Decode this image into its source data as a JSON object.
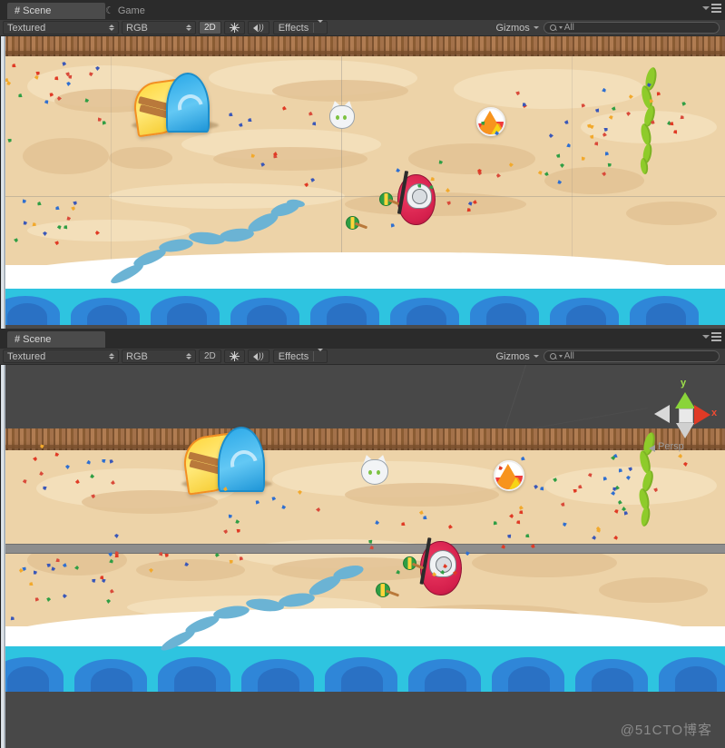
{
  "window": {
    "watermark": "@51CTO博客"
  },
  "panels": [
    {
      "id": "panel-top",
      "tabs": [
        {
          "label": "Scene",
          "icon": "grid-hash-icon",
          "active": true
        },
        {
          "label": "Game",
          "icon": "game-moon-icon",
          "active": false
        }
      ],
      "toolbar": {
        "draw_mode": "Textured",
        "color_mode": "RGB",
        "toggle_2d": "2D",
        "toggle_2d_active": true,
        "lighting_icon": "sun-icon",
        "audio_icon": "speaker-icon",
        "effects_label": "Effects",
        "effects_caret": "chevron-down-icon",
        "gizmos_label": "Gizmos",
        "search_value": "All",
        "search_icon": "search-icon"
      },
      "window_menu": {
        "caret": "chevron-down-icon",
        "menu": "hamburger-icon"
      }
    },
    {
      "id": "panel-bottom",
      "tabs": [
        {
          "label": "Scene",
          "icon": "grid-hash-icon",
          "active": true
        }
      ],
      "toolbar": {
        "draw_mode": "Textured",
        "color_mode": "RGB",
        "toggle_2d": "2D",
        "toggle_2d_active": false,
        "lighting_icon": "sun-icon",
        "audio_icon": "speaker-icon",
        "effects_label": "Effects",
        "effects_caret": "chevron-down-icon",
        "gizmos_label": "Gizmos",
        "search_value": "All",
        "search_icon": "search-icon"
      },
      "window_menu": {
        "caret": "chevron-down-icon",
        "menu": "hamburger-icon"
      },
      "gizmo": {
        "axis_y": "y",
        "axis_x": "x",
        "projection": "Persp",
        "color_y": "#8ad43a",
        "color_x": "#e03a25",
        "color_center": "#e9e9e9"
      }
    }
  ],
  "scene": {
    "name": "beach-scene",
    "colors": {
      "sand": "#edd3a8",
      "sand_shadow": "#e2c294",
      "sand_light": "#f3e0bd",
      "fence": "#9c6b3f",
      "sea": "#2ec4e0",
      "wave": "#2f86d8",
      "foam": "#ffffff",
      "letterbox": "#4a4a4a"
    },
    "objects": [
      {
        "name": "wooden-fence",
        "type": "background"
      },
      {
        "name": "surfboard-yellow",
        "type": "prop"
      },
      {
        "name": "surfboard-blue",
        "type": "prop"
      },
      {
        "name": "cat-head",
        "type": "prop"
      },
      {
        "name": "beach-ball",
        "type": "prop"
      },
      {
        "name": "green-vine-streamer",
        "type": "prop"
      },
      {
        "name": "water-ripple",
        "type": "prop"
      },
      {
        "name": "player-character",
        "type": "character"
      },
      {
        "name": "maraca",
        "type": "prop",
        "count": 2
      },
      {
        "name": "confetti",
        "type": "particles"
      },
      {
        "name": "ocean-waves",
        "type": "background"
      }
    ]
  }
}
